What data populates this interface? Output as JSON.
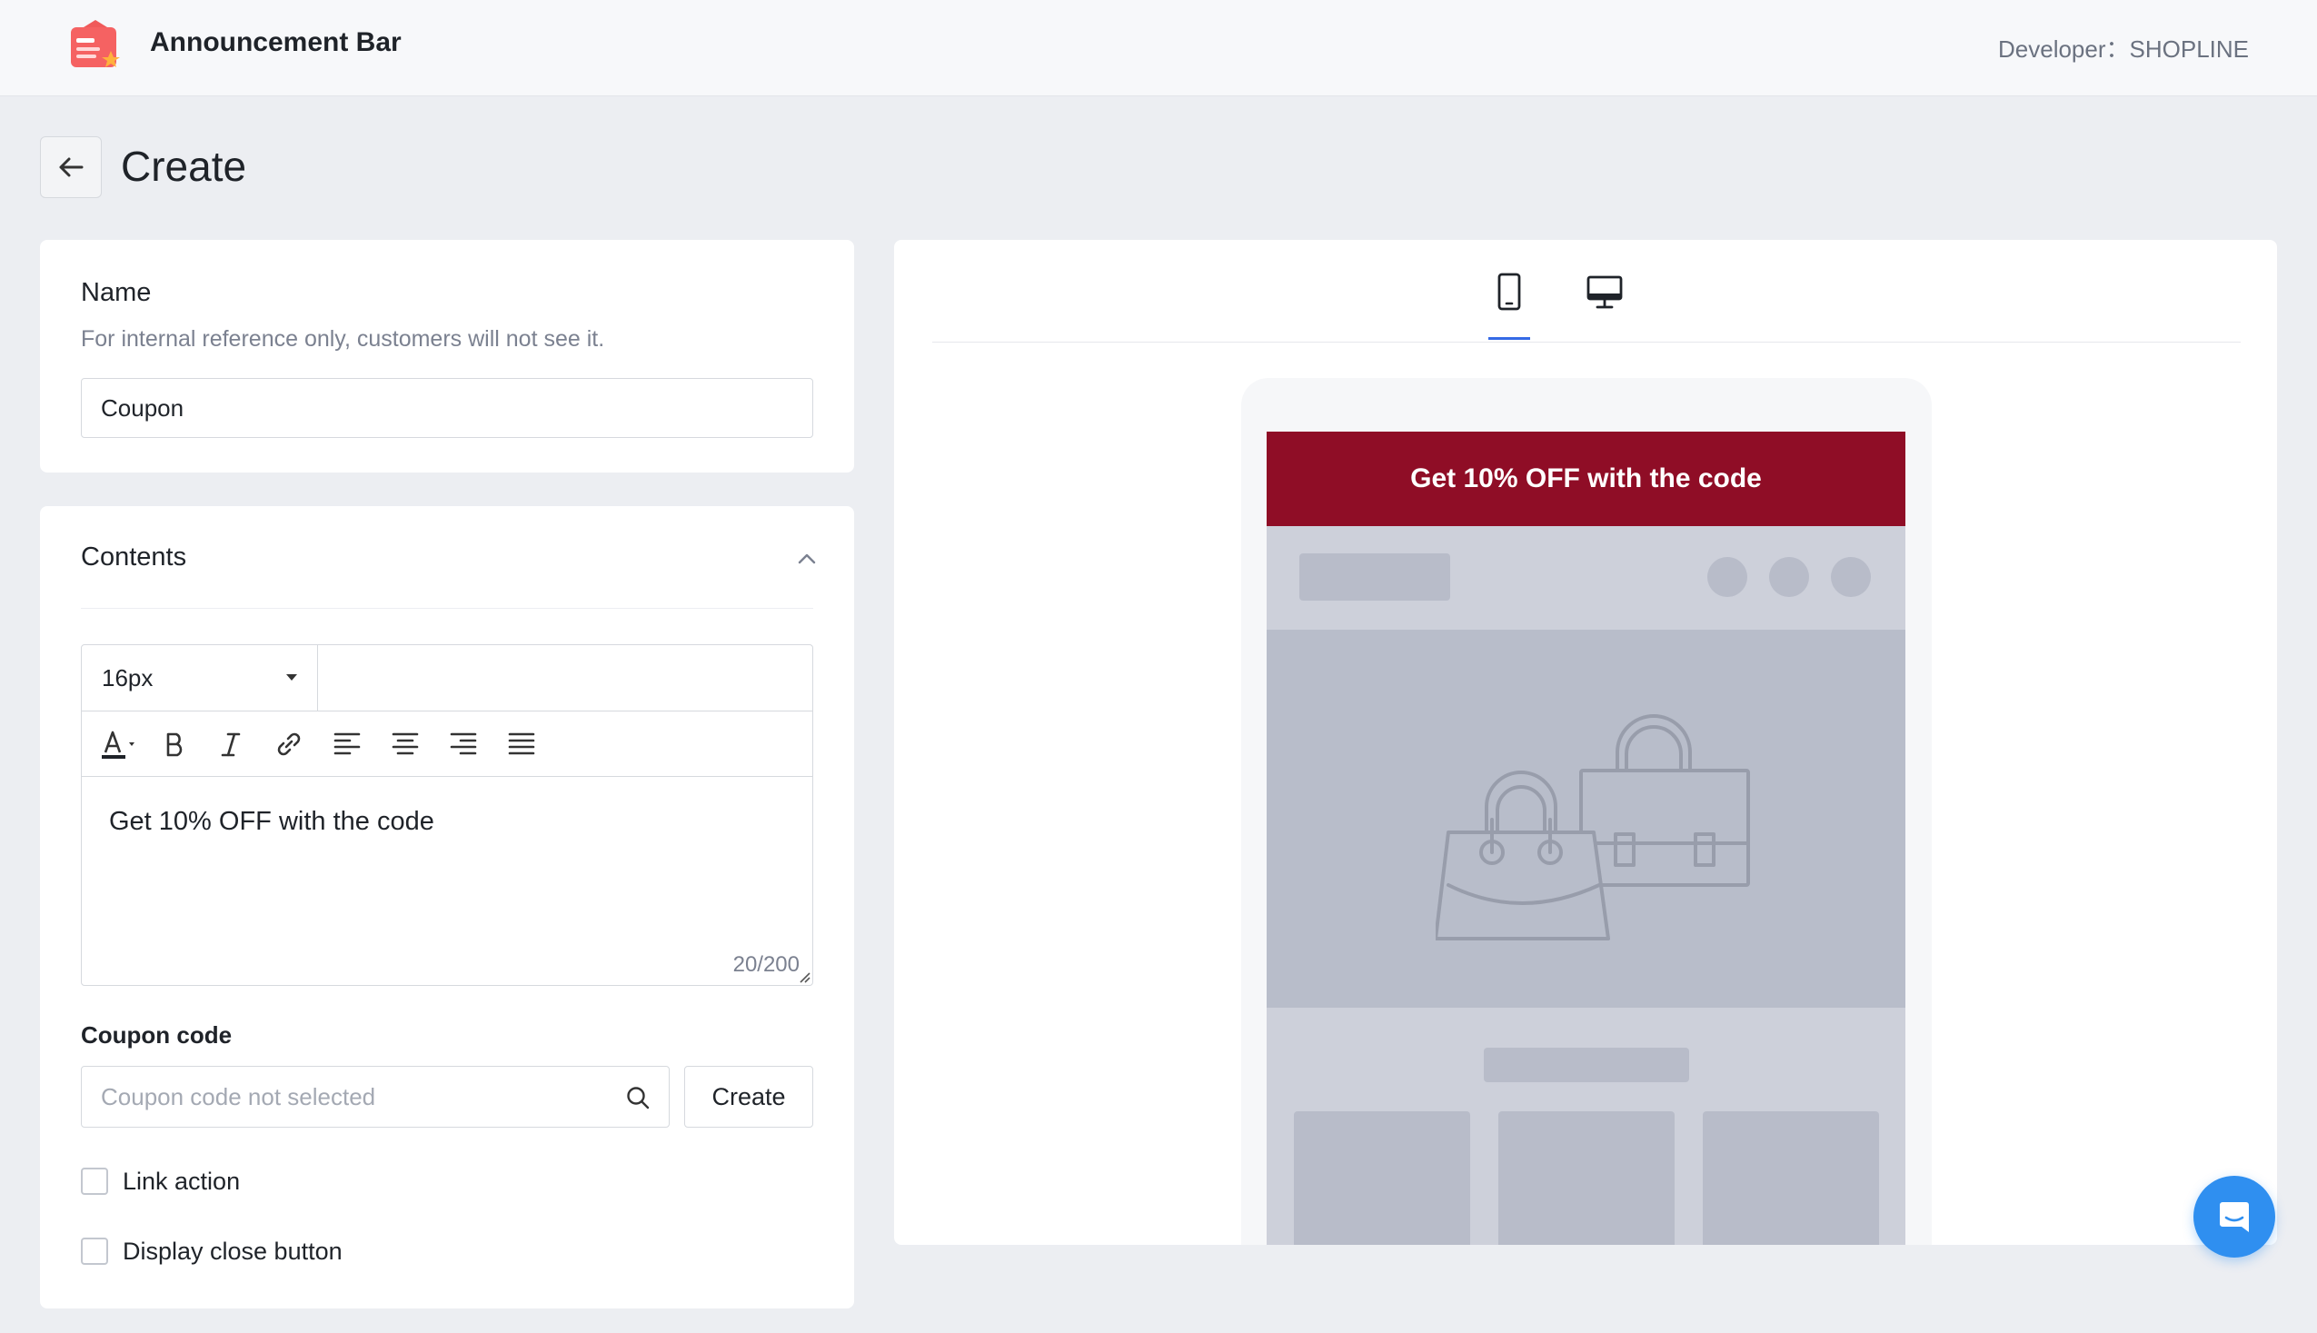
{
  "app": {
    "title": "Announcement Bar",
    "developer": "Developer：SHOPLINE",
    "logo_icon": "announcement-bar-logo-icon"
  },
  "page": {
    "title": "Create",
    "back_icon": "arrow-left-icon"
  },
  "name_card": {
    "label": "Name",
    "help": "For internal reference only, customers will not see it.",
    "value": "Coupon"
  },
  "contents_card": {
    "title": "Contents",
    "collapse_icon": "chevron-up-icon",
    "editor": {
      "font_size": "16px",
      "tools": [
        "text-color-icon",
        "bold-icon",
        "italic-icon",
        "link-icon",
        "align-left-icon",
        "align-center-icon",
        "align-right-icon",
        "align-justify-icon"
      ],
      "text": "Get 10% OFF with the code",
      "counter": "20/200"
    },
    "coupon": {
      "label": "Coupon code",
      "placeholder": "Coupon code not selected",
      "create_label": "Create"
    },
    "link_action_label": "Link action",
    "close_button_label": "Display close button"
  },
  "preview": {
    "tabs": [
      "mobile-icon",
      "desktop-icon"
    ],
    "active_tab": "mobile-icon",
    "announcement_text": "Get 10% OFF with the code",
    "announcement_bg": "#8f0d26",
    "announcement_color": "#ffffff"
  },
  "colors": {
    "accent": "#356ae6",
    "chat": "#2f8ff0"
  }
}
